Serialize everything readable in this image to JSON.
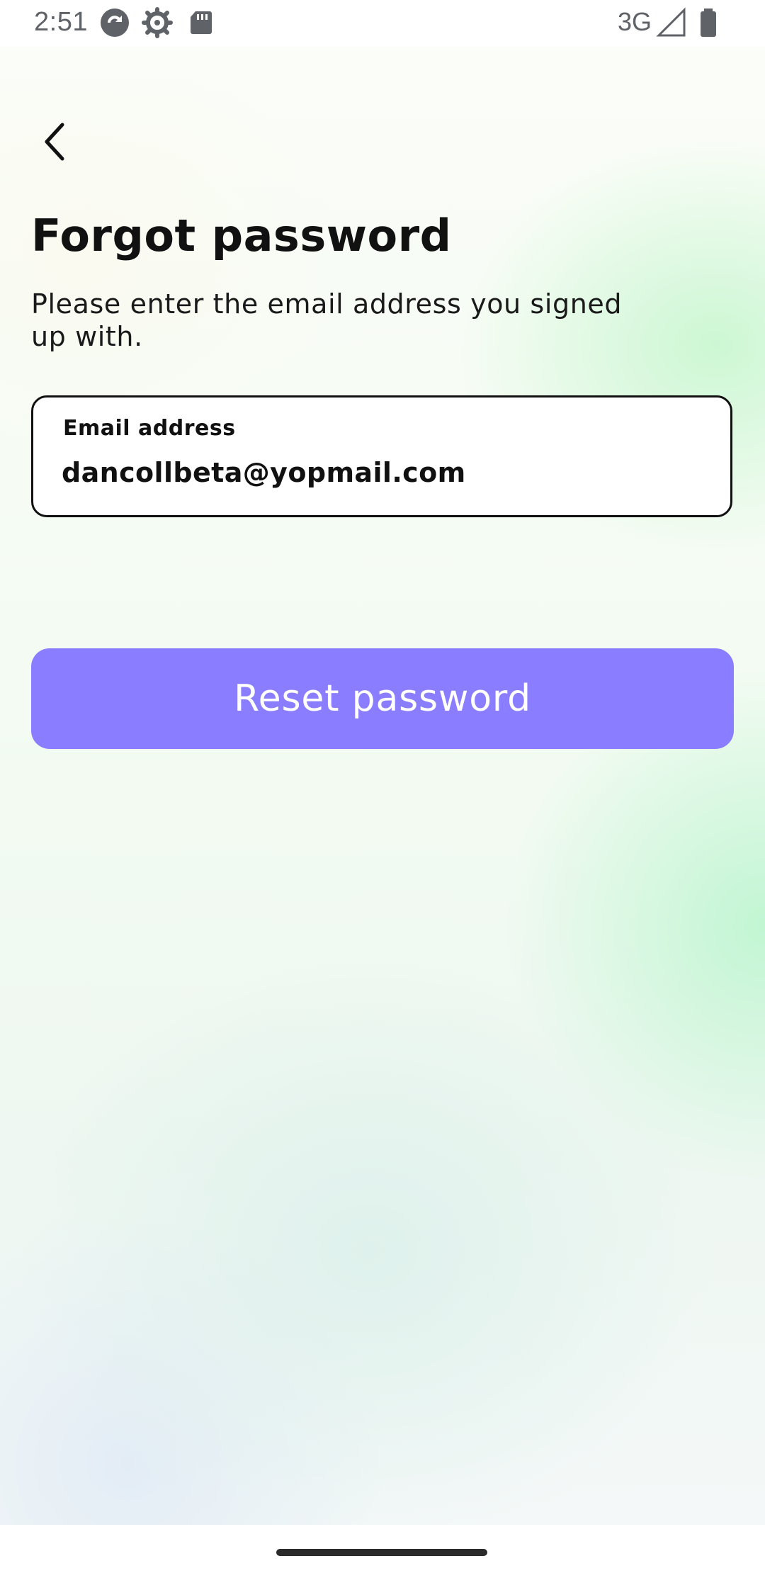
{
  "status_bar": {
    "time": "2:51",
    "network": "3G",
    "icons": [
      "sync-icon",
      "settings-gear-icon",
      "sd-card-icon",
      "signal-icon",
      "battery-icon"
    ]
  },
  "header": {
    "back_icon": "chevron-left-icon"
  },
  "page": {
    "title": "Forgot password",
    "subtitle": "Please enter the email address you signed up with."
  },
  "form": {
    "email_label": "Email address",
    "email_value": "dancollbeta@yopmail.com"
  },
  "actions": {
    "reset_label": "Reset password",
    "reset_color": "#8a7dff"
  }
}
